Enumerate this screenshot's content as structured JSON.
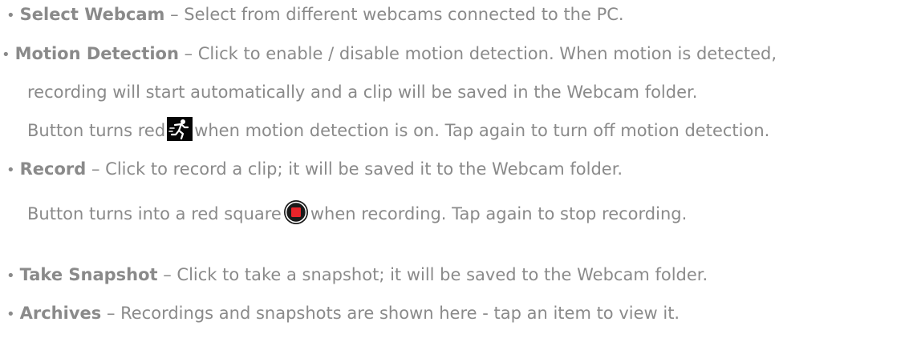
{
  "bullet": "•",
  "items": [
    {
      "term": "Select Webcam",
      "desc": " – Select from different webcams connected to the PC."
    },
    {
      "term": "Motion Detection",
      "desc": " – Click to enable / disable motion detection. When motion is detected,",
      "line2": "recording will start automatically and a clip will be saved in the Webcam folder.",
      "line3_before": "Button turns red",
      "line3_after": "when motion detection is on. Tap again to turn off motion detection.",
      "icon": "running-man-icon"
    },
    {
      "term": "Record",
      "desc": " – Click to record a clip; it will be saved it to the Webcam folder.",
      "line2_before": "Button turns into a red square",
      "line2_after": "when recording. Tap again to stop recording.",
      "icon": "record-stop-icon"
    },
    {
      "term": "Take Snapshot",
      "desc": " – Click to take a snapshot; it will be saved to the Webcam folder."
    },
    {
      "term": "Archives",
      "desc": " – Recordings and snapshots are shown here - tap an item to view it."
    }
  ],
  "colors": {
    "text": "#8a8a8a",
    "record_red": "#e8242a",
    "icon_bg": "#050505"
  }
}
